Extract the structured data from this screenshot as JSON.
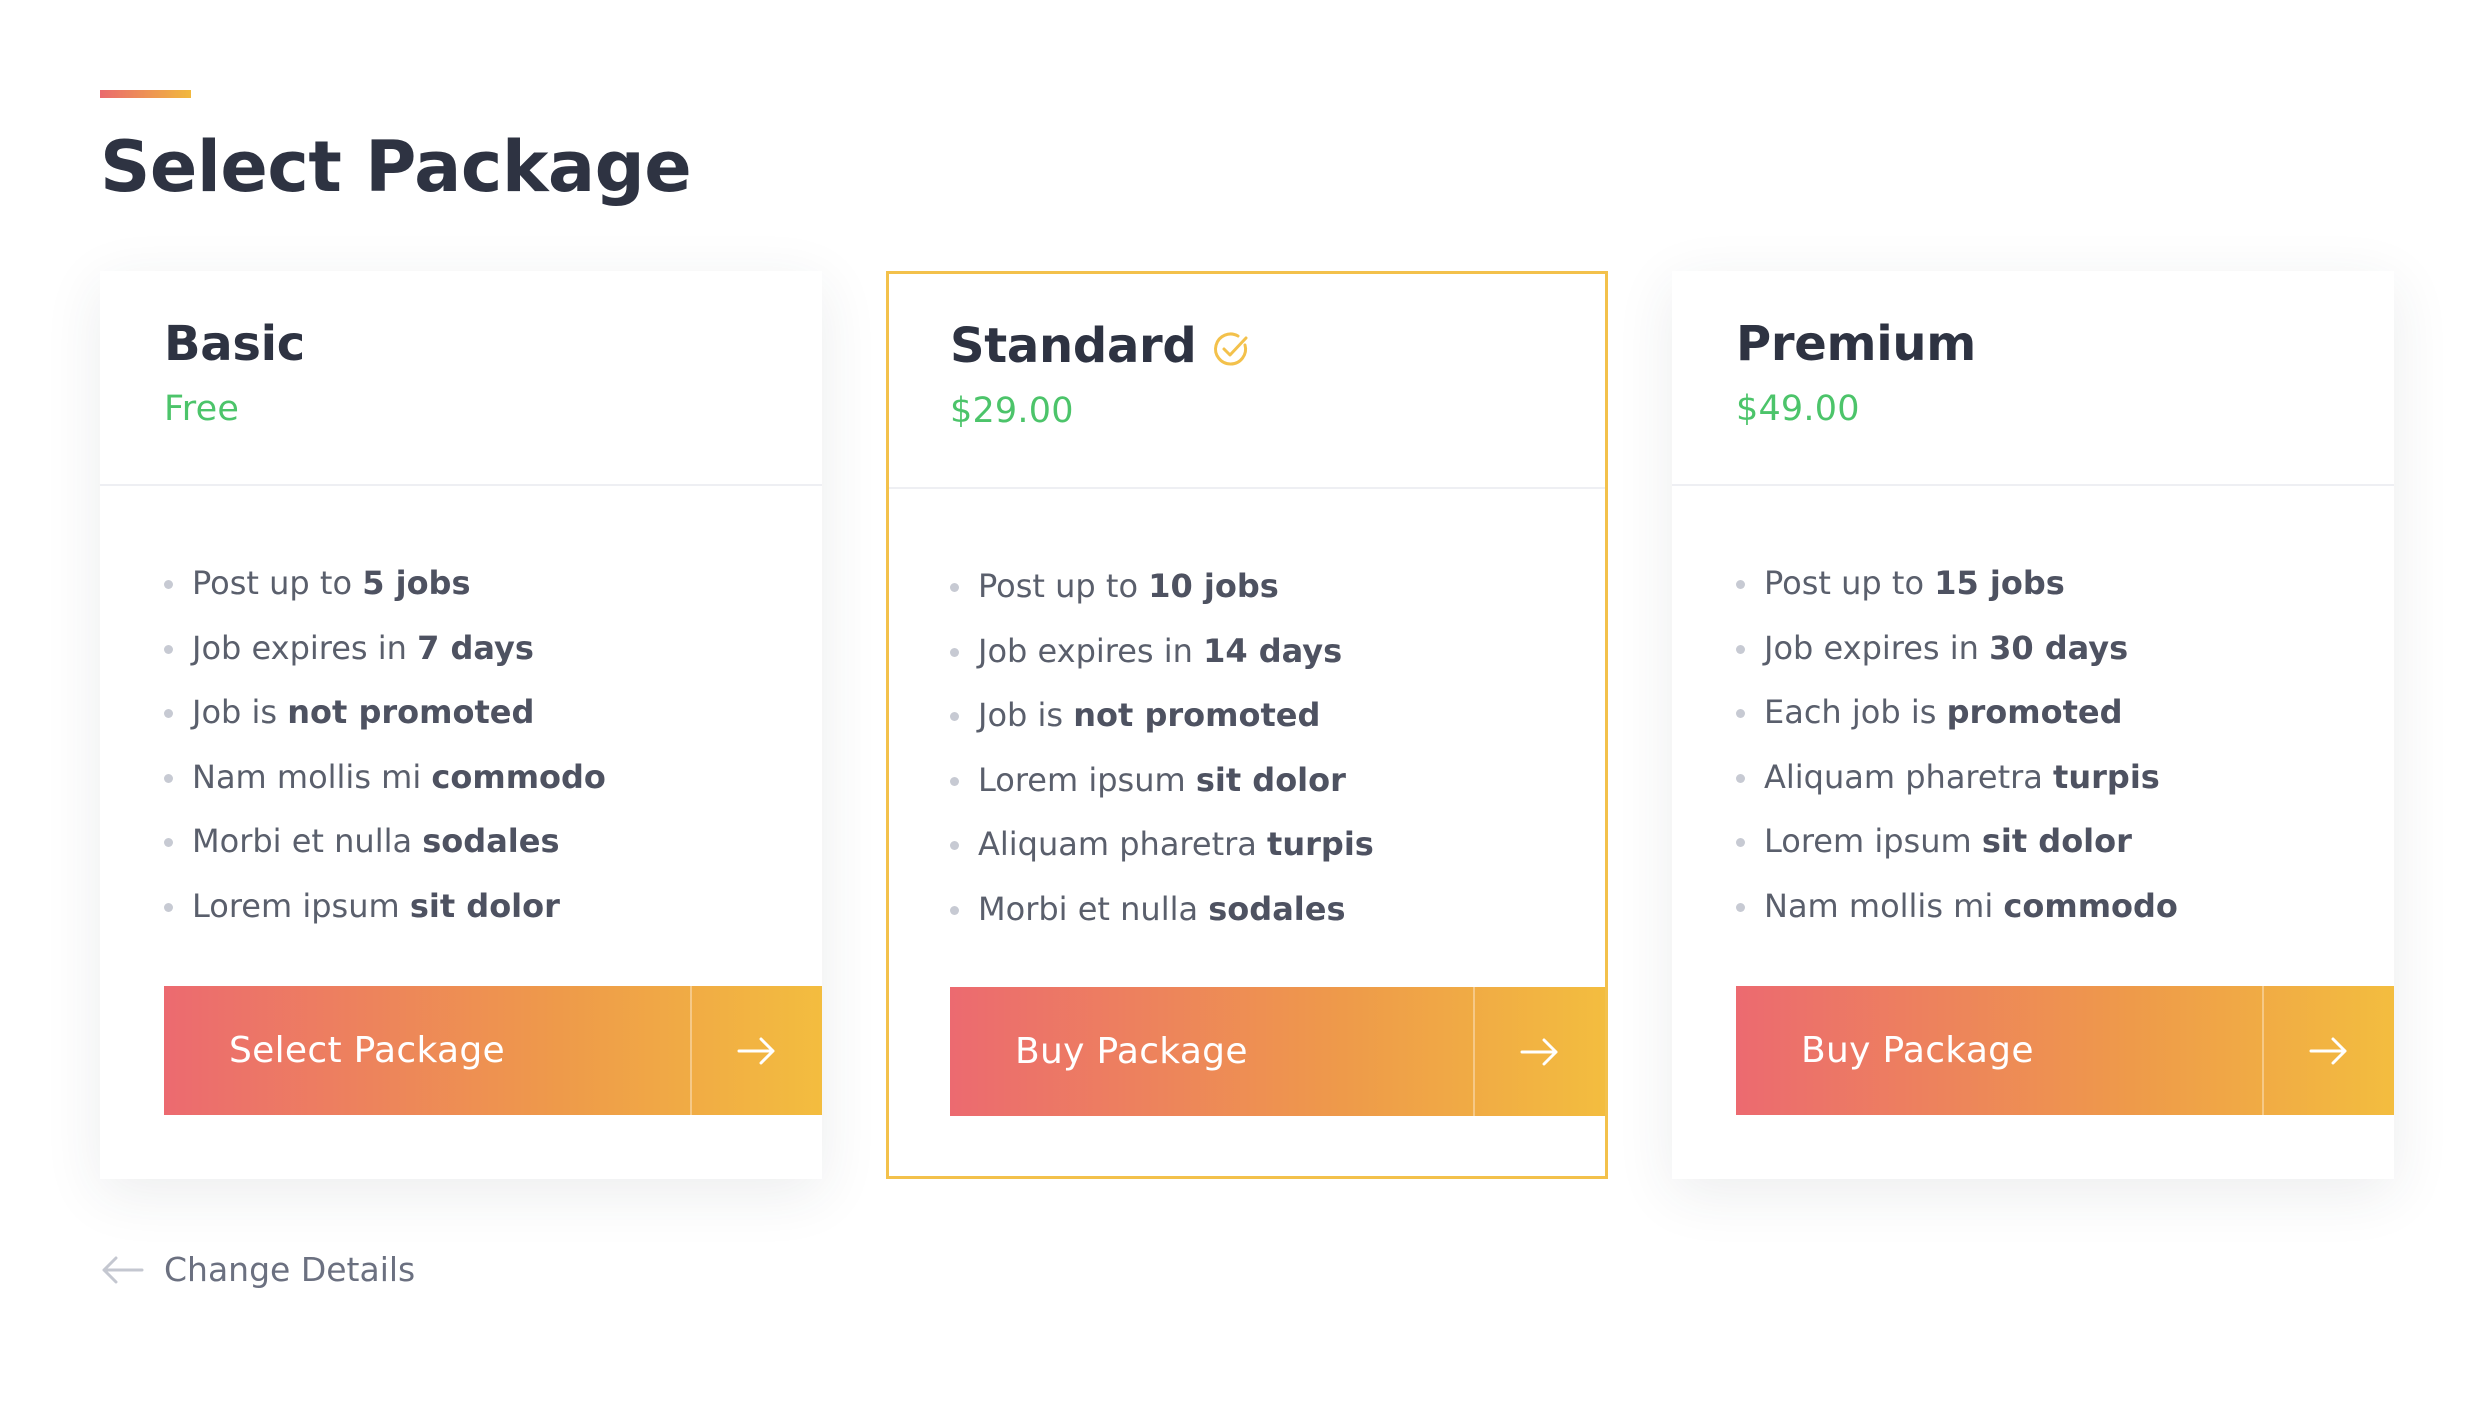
{
  "page": {
    "title": "Select Package"
  },
  "colors": {
    "accent_start": "#ea6a6e",
    "accent_end": "#f1b83d",
    "price_green": "#4cc46a",
    "selected_border": "#f3c14b"
  },
  "packages": [
    {
      "name": "Basic",
      "price": "Free",
      "selected": false,
      "features": [
        {
          "text": "Post up to ",
          "bold": "5 jobs"
        },
        {
          "text": "Job expires in ",
          "bold": "7 days"
        },
        {
          "text": "Job is ",
          "bold": "not promoted"
        },
        {
          "text": "Nam mollis mi ",
          "bold": "commodo"
        },
        {
          "text": "Morbi et nulla ",
          "bold": "sodales"
        },
        {
          "text": "Lorem ipsum ",
          "bold": "sit dolor"
        }
      ],
      "button_label": "Select Package"
    },
    {
      "name": "Standard",
      "price": "$29.00",
      "selected": true,
      "features": [
        {
          "text": "Post up to ",
          "bold": "10 jobs"
        },
        {
          "text": "Job expires in ",
          "bold": "14 days"
        },
        {
          "text": "Job is ",
          "bold": "not promoted"
        },
        {
          "text": "Lorem ipsum ",
          "bold": "sit dolor"
        },
        {
          "text": "Aliquam pharetra ",
          "bold": "turpis"
        },
        {
          "text": "Morbi et nulla ",
          "bold": "sodales"
        }
      ],
      "button_label": "Buy Package"
    },
    {
      "name": "Premium",
      "price": "$49.00",
      "selected": false,
      "features": [
        {
          "text": "Post up to ",
          "bold": "15 jobs"
        },
        {
          "text": "Job expires in ",
          "bold": "30 days"
        },
        {
          "text": "Each job is ",
          "bold": "promoted"
        },
        {
          "text": "Aliquam pharetra ",
          "bold": "turpis"
        },
        {
          "text": "Lorem ipsum ",
          "bold": "sit dolor"
        },
        {
          "text": "Nam mollis mi ",
          "bold": "commodo"
        }
      ],
      "button_label": "Buy Package"
    }
  ],
  "icons": {
    "selected": "check-circle-icon",
    "button": "arrow-right-icon",
    "back": "arrow-left-icon"
  },
  "back_link": {
    "label": "Change Details"
  }
}
